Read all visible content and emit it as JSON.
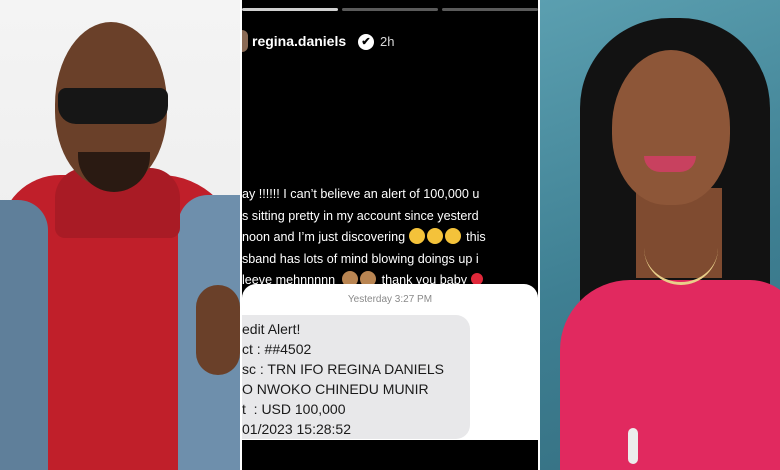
{
  "story": {
    "username": "regina.daniels",
    "verified_glyph": "✔",
    "time": "2h",
    "lines": [
      "ay !!!!!! I can’t believe an alert of 100,000 u",
      "s sitting pretty in my account since yesterd",
      "noon and I’m just discovering",
      "this",
      "sband has lots of mind blowing doings up i",
      "leeve mehnnnnn",
      "thank you baby"
    ]
  },
  "sms": {
    "timestamp": "Yesterday 3:27 PM",
    "lines": [
      "edit Alert!",
      "ct : ##4502",
      "sc : TRN IFO REGINA DANIELS",
      "O NWOKO CHINEDU MUNIR",
      "t  : USD 100,000",
      "01/2023 15:28:52"
    ]
  },
  "icons": {
    "verified": "verified-badge-icon",
    "emoji_pleading": "pleading-face-emoji-icon",
    "emoji_monkey": "see-no-evil-monkey-emoji-icon",
    "heart": "red-heart-icon"
  },
  "colors": {
    "story_bg": "#000000",
    "sms_bubble": "#e8e8ea",
    "dress": "#e1295f",
    "turtleneck": "#c01f2a",
    "backdrop_right": "#4a8ea1"
  }
}
